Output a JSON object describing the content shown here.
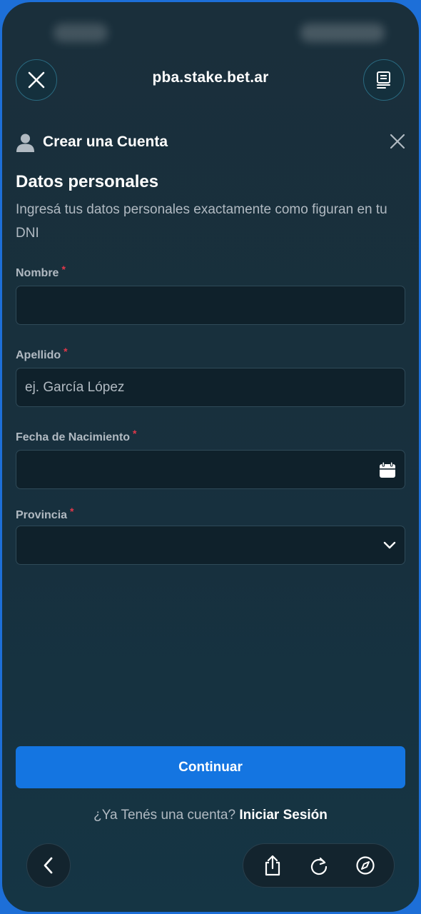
{
  "browser": {
    "url_title": "pba.stake.bet.ar"
  },
  "modal": {
    "title": "Crear una Cuenta",
    "section_title": "Datos personales",
    "section_subtitle": "Ingresá tus datos personales exactamente como figuran en tu DNI"
  },
  "form": {
    "required_marker": "*",
    "nombre": {
      "label": "Nombre",
      "value": "",
      "placeholder": ""
    },
    "apellido": {
      "label": "Apellido",
      "value": "",
      "placeholder": "ej. García López"
    },
    "fecha_nacimiento": {
      "label": "Fecha de Nacimiento",
      "value": "",
      "placeholder": ""
    },
    "provincia": {
      "label": "Provincia",
      "selected": ""
    },
    "continue_label": "Continuar"
  },
  "footer": {
    "question": "¿Ya Tenés una cuenta?",
    "login_link": "Iniciar Sesión"
  },
  "icons": {
    "close": "close-icon",
    "reader": "reader-mode-icon",
    "user": "user-icon",
    "calendar": "calendar-icon",
    "chevron": "chevron-down-icon",
    "back": "chevron-left-icon",
    "share": "share-icon",
    "reload": "reload-icon",
    "compass": "compass-icon"
  },
  "colors": {
    "accent": "#1475e1",
    "background": "#17303e",
    "required": "#e2384a"
  }
}
